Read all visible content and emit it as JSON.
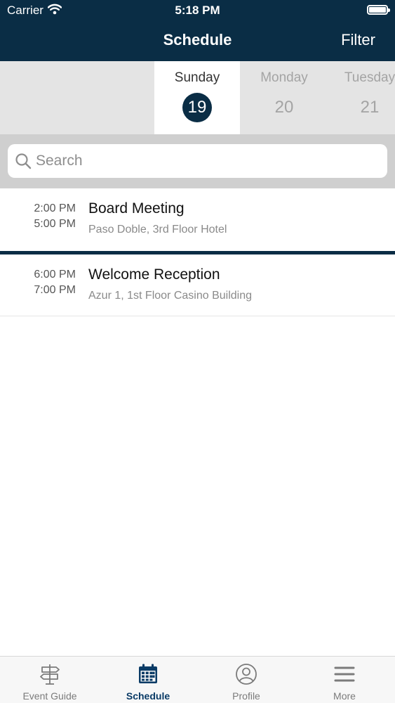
{
  "status_bar": {
    "carrier": "Carrier",
    "time": "5:18 PM"
  },
  "nav": {
    "title": "Schedule",
    "filter_label": "Filter"
  },
  "days": [
    {
      "name": "Sunday",
      "number": "19",
      "selected": true
    },
    {
      "name": "Monday",
      "number": "20",
      "selected": false
    },
    {
      "name": "Tuesday",
      "number": "21",
      "selected": false
    }
  ],
  "search": {
    "placeholder": "Search",
    "value": ""
  },
  "events": [
    {
      "start": "2:00 PM",
      "end": "5:00 PM",
      "title": "Board Meeting",
      "location": "Paso Doble, 3rd Floor Hotel"
    },
    {
      "start": "6:00 PM",
      "end": "7:00 PM",
      "title": "Welcome Reception",
      "location": "Azur 1, 1st Floor Casino Building"
    }
  ],
  "tabs": [
    {
      "label": "Event Guide",
      "icon": "signpost-icon",
      "active": false
    },
    {
      "label": "Schedule",
      "icon": "calendar-icon",
      "active": true
    },
    {
      "label": "Profile",
      "icon": "profile-icon",
      "active": false
    },
    {
      "label": "More",
      "icon": "menu-icon",
      "active": false
    }
  ],
  "colors": {
    "primary": "#0a2d45",
    "tab_active": "#0a3b66",
    "tab_inactive": "#7b7b7b"
  }
}
